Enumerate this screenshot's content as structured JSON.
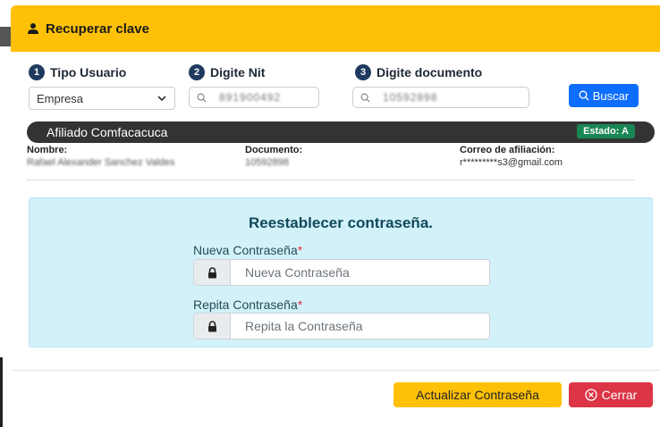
{
  "modal": {
    "title": "Recuperar clave"
  },
  "search": {
    "steps": [
      {
        "num": "1",
        "label": "Tipo Usuario"
      },
      {
        "num": "2",
        "label": "Digite Nit"
      },
      {
        "num": "3",
        "label": "Digite documento"
      }
    ],
    "tipo_usuario_value": "Empresa",
    "nit_value": "891900492",
    "documento_value": "10592898",
    "buscar_label": "Buscar"
  },
  "afiliado": {
    "title": "Afiliado Comfacacuca",
    "estado": "Estado: A",
    "nombre_label": "Nombre:",
    "nombre_value": "Rafael Alexander Sanchez Valdes",
    "documento_label": "Documento:",
    "documento_value": "10592898",
    "correo_label": "Correo de afiliación:",
    "correo_value": "r*********s3@gmail.com"
  },
  "reset": {
    "title": "Reestablecer contraseña.",
    "new_label": "Nueva Contraseña",
    "new_placeholder": "Nueva Contraseña",
    "repeat_label": "Repita Contraseña",
    "repeat_placeholder": "Repita la Contraseña",
    "required_mark": "*"
  },
  "footer": {
    "update_label": "Actualizar Contraseña",
    "close_label": "Cerrar"
  },
  "colors": {
    "header": "#ffc107",
    "primary": "#0d6efd",
    "danger": "#dc3545",
    "success": "#198754",
    "panel": "#d3f1f9"
  }
}
